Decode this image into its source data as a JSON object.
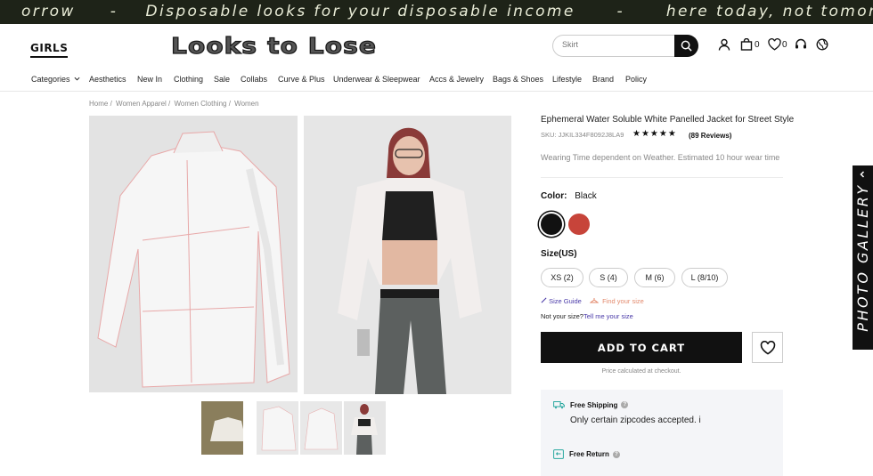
{
  "ticker": {
    "text": "orrow     -    Disposable looks for your disposable income      -      here today, not tomorrow     -"
  },
  "header": {
    "girls": "GIRLS",
    "logo": "Looks to Lose",
    "search_placeholder": "Skirt",
    "cart_count": "0",
    "wishlist_count": "0"
  },
  "nav": {
    "items": [
      "Categories",
      "Aesthetics",
      "New In",
      "Clothing",
      "Sale",
      "Collabs",
      "Curve & Plus",
      "Underwear & Sleepwear",
      "Accs & Jewelry",
      "Bags & Shoes",
      "Lifestyle",
      "Brand",
      "Policy"
    ]
  },
  "breadcrumb": [
    "Home /",
    "Women Apparel /",
    "Women Clothing /",
    "Women"
  ],
  "product": {
    "title": "Ephemeral Water Soluble White Panelled Jacket for Street Style",
    "sku": "SKU: JJKIL334F8092J8LA9",
    "rating_stars": "★★★★★",
    "reviews": "(89 Reviews)",
    "wear_note": "Wearing Time dependent on Weather. Estimated 10 hour wear time",
    "color_label": "Color:",
    "color_value": "Black",
    "colors": [
      "#111111",
      "#c7443a"
    ],
    "size_label": "Size(US)",
    "sizes": [
      "XS (2)",
      "S (4)",
      "M (6)",
      "L (8/10)"
    ],
    "size_guide": "Size Guide",
    "find_size": "Find your size",
    "not_size": "Not your size?",
    "tell_me": "Tell me your size",
    "add_to_cart": "ADD TO CART",
    "price_note": "Price calculated at checkout."
  },
  "shipping": {
    "free_shipping": "Free Shipping",
    "zip_note": "Only certain zipcodes accepted. i",
    "free_return": "Free Return"
  },
  "gallery": {
    "label": "PHOTO GALLERY"
  },
  "colors": {
    "accent": "#111111",
    "link": "#4a3aa8",
    "ticker_bg": "#1e2318",
    "teal_icon": "#2aa8a0"
  }
}
